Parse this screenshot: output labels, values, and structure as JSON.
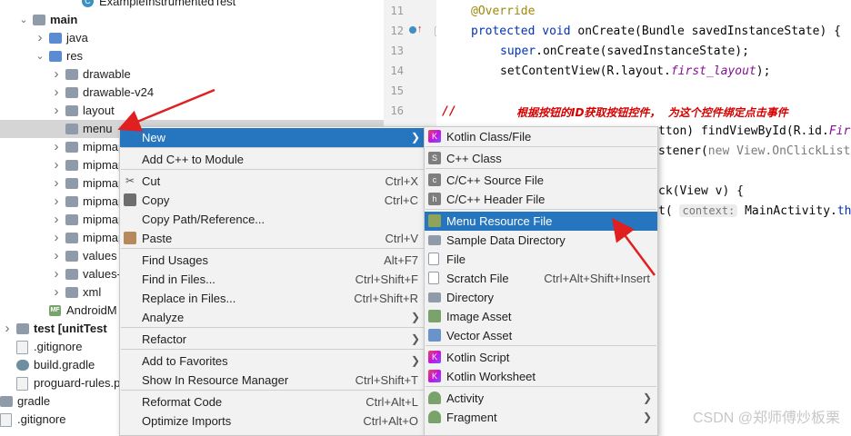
{
  "tree": {
    "items": [
      {
        "label": "ExampleInstrumentedTest",
        "icon": "class-icon",
        "arrow": ""
      },
      {
        "label": "main",
        "icon": "folder-icon",
        "arrow": "v",
        "bold": true
      },
      {
        "label": "java",
        "icon": "folder-icon",
        "arrow": ">"
      },
      {
        "label": "res",
        "icon": "folder-icon",
        "arrow": "v"
      },
      {
        "label": "drawable",
        "icon": "folder-icon",
        "arrow": ">"
      },
      {
        "label": "drawable-v24",
        "icon": "folder-icon",
        "arrow": ">"
      },
      {
        "label": "layout",
        "icon": "folder-icon",
        "arrow": ">"
      },
      {
        "label": "menu",
        "icon": "folder-icon",
        "arrow": "",
        "selected": true
      },
      {
        "label": "mipmap",
        "icon": "folder-icon",
        "arrow": ">"
      },
      {
        "label": "mipmap",
        "icon": "folder-icon",
        "arrow": ">"
      },
      {
        "label": "mipmap",
        "icon": "folder-icon",
        "arrow": ">"
      },
      {
        "label": "mipmap",
        "icon": "folder-icon",
        "arrow": ">"
      },
      {
        "label": "mipmap",
        "icon": "folder-icon",
        "arrow": ">"
      },
      {
        "label": "mipmap",
        "icon": "folder-icon",
        "arrow": ">"
      },
      {
        "label": "values",
        "icon": "folder-icon",
        "arrow": ">"
      },
      {
        "label": "values-",
        "icon": "folder-icon",
        "arrow": ">"
      },
      {
        "label": "xml",
        "icon": "folder-icon",
        "arrow": ">"
      },
      {
        "label": "AndroidM",
        "icon": "manifest-icon",
        "arrow": ""
      },
      {
        "label": "test [unitTest",
        "icon": "folder-icon",
        "arrow": ">",
        "bold": true
      },
      {
        "label": ".gitignore",
        "icon": "file-icon",
        "arrow": ""
      },
      {
        "label": "build.gradle",
        "icon": "gradle-icon",
        "arrow": ""
      },
      {
        "label": "proguard-rules.p",
        "icon": "file-icon",
        "arrow": ""
      },
      {
        "label": "gradle",
        "icon": "folder-icon",
        "arrow": ">"
      },
      {
        "label": ".gitignore",
        "icon": "file-icon",
        "arrow": ""
      }
    ]
  },
  "editor": {
    "line_numbers": [
      "11",
      "12",
      "13",
      "14",
      "15",
      "16"
    ],
    "code": {
      "l1_annotation": "@Override",
      "l2_kw": "protected void",
      "l2_rest": " onCreate(Bundle savedInstanceState) {",
      "l3_kw": "super",
      "l3_rest": ".onCreate(savedInstanceState);",
      "l4_a": "setContentView(R.layout.",
      "l4_field": "first_layout",
      "l4_b": ");",
      "l6_comment_mark": "//",
      "l6_comment": "根据按钮的ID获取按钮控件，  为这个控件绑定点击事件",
      "l7_a": "tton) findViewById(R.id.",
      "l7_field": "Fir",
      "l8_a": "stener(",
      "l8_kw": "new",
      "l8_b": " View.OnClickList",
      "l9_a": "ck(View v) {",
      "l10_a": "t(",
      "l10_hint": "context:",
      "l10_b": " MainActivity.",
      "l10_kw": "this",
      "l10_c": ","
    }
  },
  "context_menu": {
    "items": [
      {
        "label": "New",
        "shortcut": "",
        "submenu": true,
        "active": true
      },
      {
        "label": "Add C++ to Module",
        "shortcut": "",
        "submenu": false
      },
      {
        "label": "Cut",
        "shortcut": "Ctrl+X",
        "icon": "cut-icon"
      },
      {
        "label": "Copy",
        "shortcut": "Ctrl+C",
        "icon": "copy-icon"
      },
      {
        "label": "Copy Path/Reference...",
        "shortcut": ""
      },
      {
        "label": "Paste",
        "shortcut": "Ctrl+V",
        "icon": "paste-icon"
      },
      {
        "label": "Find Usages",
        "shortcut": "Alt+F7"
      },
      {
        "label": "Find in Files...",
        "shortcut": "Ctrl+Shift+F"
      },
      {
        "label": "Replace in Files...",
        "shortcut": "Ctrl+Shift+R"
      },
      {
        "label": "Analyze",
        "shortcut": "",
        "submenu": true
      },
      {
        "label": "Refactor",
        "shortcut": "",
        "submenu": true
      },
      {
        "label": "Add to Favorites",
        "shortcut": "",
        "submenu": true
      },
      {
        "label": "Show In Resource Manager",
        "shortcut": "Ctrl+Shift+T"
      },
      {
        "label": "Reformat Code",
        "shortcut": "Ctrl+Alt+L"
      },
      {
        "label": "Optimize Imports",
        "shortcut": "Ctrl+Alt+O"
      }
    ]
  },
  "new_submenu": {
    "items": [
      {
        "label": "Kotlin Class/File",
        "icon": "kotlin-icon",
        "glyph": "K"
      },
      {
        "label": "C++ Class",
        "icon": "cpp-class-icon",
        "glyph": "S"
      },
      {
        "label": "C/C++ Source File",
        "icon": "cpp-source-icon",
        "glyph": "c"
      },
      {
        "label": "C/C++ Header File",
        "icon": "cpp-header-icon",
        "glyph": "h"
      },
      {
        "label": "Menu Resource File",
        "icon": "resource-file-icon",
        "glyph": "",
        "active": true
      },
      {
        "label": "Sample Data Directory",
        "icon": "folder-icon",
        "glyph": ""
      },
      {
        "label": "File",
        "icon": "file-icon",
        "glyph": ""
      },
      {
        "label": "Scratch File",
        "icon": "scratch-file-icon",
        "glyph": "",
        "shortcut": "Ctrl+Alt+Shift+Insert"
      },
      {
        "label": "Directory",
        "icon": "folder-icon",
        "glyph": ""
      },
      {
        "label": "Image Asset",
        "icon": "image-asset-icon",
        "glyph": ""
      },
      {
        "label": "Vector Asset",
        "icon": "vector-asset-icon",
        "glyph": ""
      },
      {
        "label": "Kotlin Script",
        "icon": "kotlin-script-icon",
        "glyph": "K"
      },
      {
        "label": "Kotlin Worksheet",
        "icon": "kotlin-worksheet-icon",
        "glyph": "K"
      },
      {
        "label": "Activity",
        "icon": "android-icon",
        "glyph": "",
        "submenu": true
      },
      {
        "label": "Fragment",
        "icon": "android-icon",
        "glyph": "",
        "submenu": true
      }
    ]
  },
  "watermark": "CSDN @郑师傅炒板栗",
  "colors": {
    "menu_highlight": "#2675bf",
    "annotation_arrow": "#e02020",
    "comment": "#d60000"
  }
}
